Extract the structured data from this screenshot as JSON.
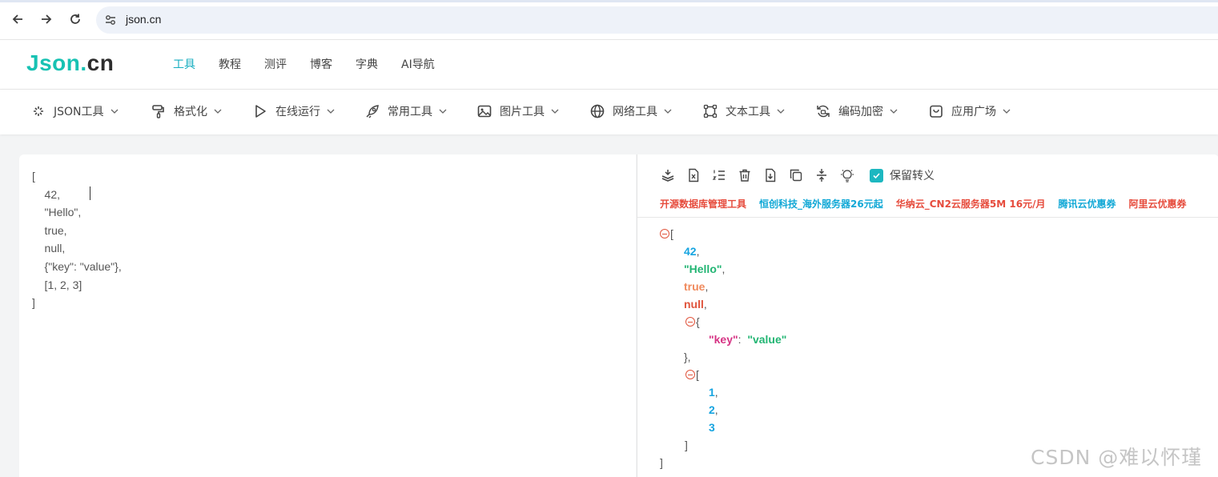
{
  "browser": {
    "url": "json.cn",
    "icons": [
      "back-icon",
      "forward-icon",
      "reload-icon",
      "site-settings-icon"
    ]
  },
  "site": {
    "logo_part1": "Json.",
    "logo_part2": "cn",
    "accent": "#17c2b3",
    "top_nav": [
      "工具",
      "教程",
      "测评",
      "博客",
      "字典",
      "AI导航"
    ],
    "top_nav_active": "工具"
  },
  "tool_nav": [
    {
      "label": "JSON工具",
      "icon": "sparkle-icon"
    },
    {
      "label": "格式化",
      "icon": "paint-roller-icon"
    },
    {
      "label": "在线运行",
      "icon": "play-icon"
    },
    {
      "label": "常用工具",
      "icon": "rocket-icon"
    },
    {
      "label": "图片工具",
      "icon": "image-icon"
    },
    {
      "label": "网络工具",
      "icon": "globe-icon"
    },
    {
      "label": "文本工具",
      "icon": "text-frame-icon"
    },
    {
      "label": "编码加密",
      "icon": "refresh-lock-icon"
    },
    {
      "label": "应用广场",
      "icon": "bag-icon"
    }
  ],
  "editor": {
    "lines": [
      "[",
      "    42,",
      "    \"Hello\",",
      "    true,",
      "    null,",
      "    {\"key\": \"value\"},",
      "    [1, 2, 3]",
      "]"
    ]
  },
  "right_toolbar": {
    "icons": [
      "compress-icon",
      "excel-icon",
      "list-order-icon",
      "trash-icon",
      "download-icon",
      "copy-icon",
      "collapse-icon",
      "bulb-icon"
    ],
    "checkbox_label": "保留转义",
    "checkbox_checked": true
  },
  "promos": [
    {
      "text": "开源数据库管理工具",
      "color": "#e64b3c"
    },
    {
      "text": "恒创科技_海外服务器26元起",
      "color": "#11a8d6"
    },
    {
      "text": "华纳云_CN2云服务器5M 16元/月",
      "color": "#e64b3c"
    },
    {
      "text": "腾讯云优惠券",
      "color": "#11a8d6"
    },
    {
      "text": "阿里云优惠券",
      "color": "#e64b3c"
    }
  ],
  "viewer": {
    "open_bracket": "[",
    "close_bracket": "]",
    "v_num": "42",
    "v_str": "\"Hello\"",
    "v_bool": "true",
    "v_null": "null",
    "obj_open": "{",
    "obj_key": "\"key\"",
    "obj_val": "\"value\"",
    "obj_close": "},",
    "arr_open": "[",
    "arr_items": [
      "1",
      "2",
      "3"
    ],
    "arr_close": "]",
    "comma": ",",
    "colon": ":"
  },
  "watermark": "CSDN @难以怀瑾"
}
